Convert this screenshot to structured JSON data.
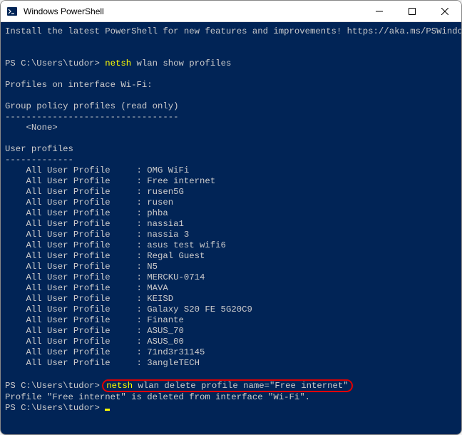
{
  "window": {
    "title": "Windows PowerShell"
  },
  "install_msg": "Install the latest PowerShell for new features and improvements! https://aka.ms/PSWindows",
  "prompt1": {
    "path": "PS C:\\Users\\tudor> ",
    "cmd_hl": "netsh",
    "cmd_rest": " wlan show profiles"
  },
  "iface_header": "Profiles on interface Wi-Fi:",
  "group_header": "Group policy profiles (read only)",
  "group_dashes": "---------------------------------",
  "group_none": "    <None>",
  "user_header": "User profiles",
  "user_dashes": "-------------",
  "profiles": [
    {
      "label": "    All User Profile     : ",
      "name": "OMG WiFi"
    },
    {
      "label": "    All User Profile     : ",
      "name": "Free internet"
    },
    {
      "label": "    All User Profile     : ",
      "name": "rusen5G"
    },
    {
      "label": "    All User Profile     : ",
      "name": "rusen"
    },
    {
      "label": "    All User Profile     : ",
      "name": "phba"
    },
    {
      "label": "    All User Profile     : ",
      "name": "nassia1"
    },
    {
      "label": "    All User Profile     : ",
      "name": "nassia 3"
    },
    {
      "label": "    All User Profile     : ",
      "name": "asus test wifi6"
    },
    {
      "label": "    All User Profile     : ",
      "name": "Regal Guest"
    },
    {
      "label": "    All User Profile     : ",
      "name": "N5"
    },
    {
      "label": "    All User Profile     : ",
      "name": "MERCKU-0714"
    },
    {
      "label": "    All User Profile     : ",
      "name": "MAVA"
    },
    {
      "label": "    All User Profile     : ",
      "name": "KEISD"
    },
    {
      "label": "    All User Profile     : ",
      "name": "Galaxy S20 FE 5G20C9"
    },
    {
      "label": "    All User Profile     : ",
      "name": "Finante"
    },
    {
      "label": "    All User Profile     : ",
      "name": "ASUS_70"
    },
    {
      "label": "    All User Profile     : ",
      "name": "ASUS_00"
    },
    {
      "label": "    All User Profile     : ",
      "name": "71nd3r31145"
    },
    {
      "label": "    All User Profile     : ",
      "name": "3angleTECH"
    }
  ],
  "prompt2": {
    "path": "PS C:\\Users\\tudor> ",
    "cmd_hl": "netsh",
    "cmd_rest": " wlan delete profile name=\"Free internet\""
  },
  "delete_result": "Profile \"Free internet\" is deleted from interface \"Wi-Fi\".",
  "prompt3": {
    "path": "PS C:\\Users\\tudor> "
  }
}
